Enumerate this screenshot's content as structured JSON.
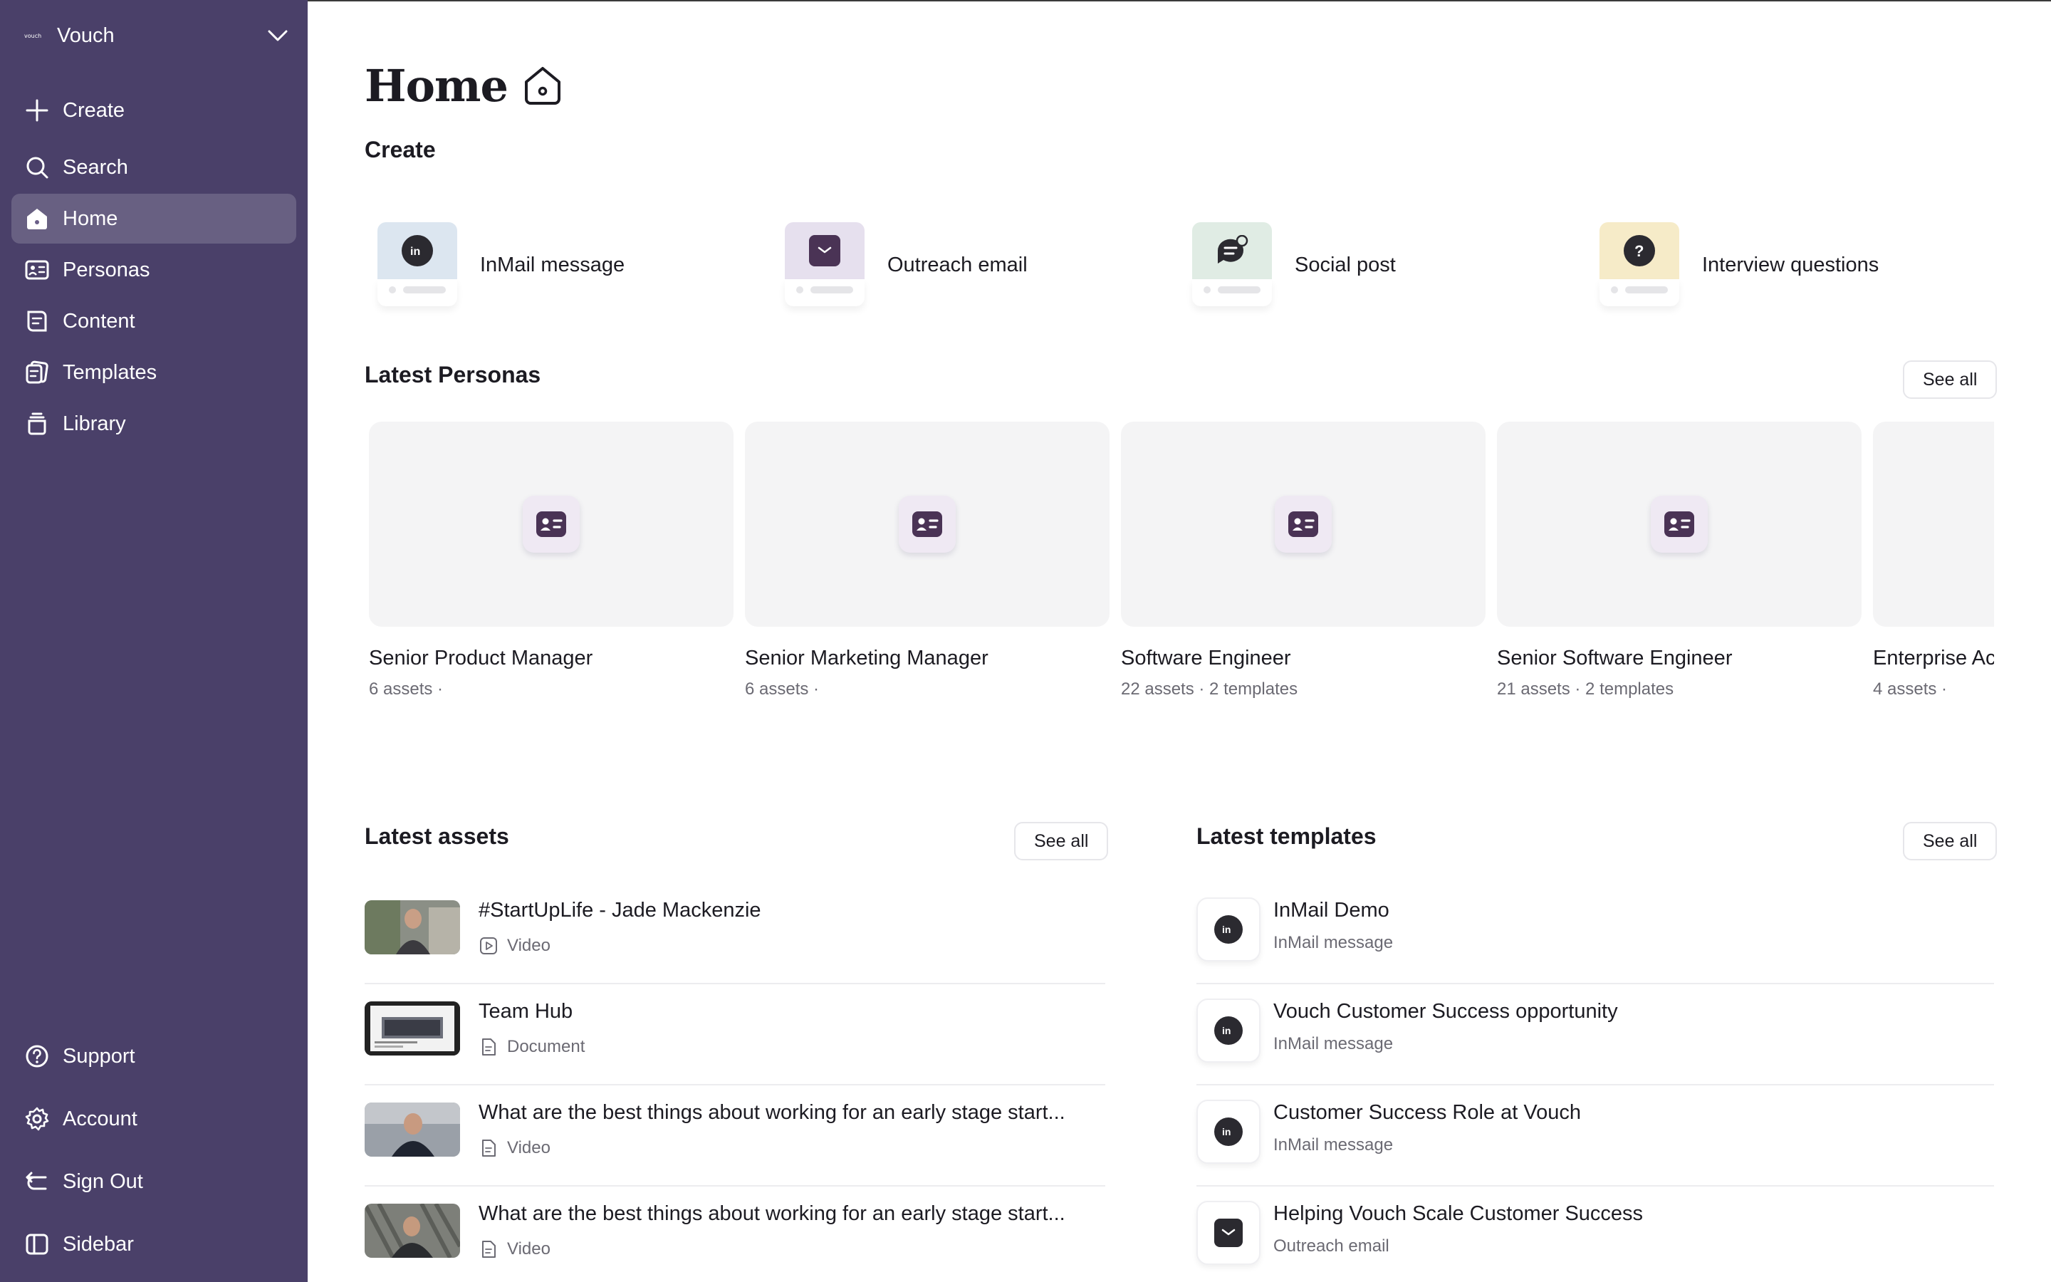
{
  "workspace": {
    "logo_text": "vouch",
    "name": "Vouch"
  },
  "sidebar": {
    "top_items": [
      {
        "label": "Create",
        "icon": "plus-icon"
      },
      {
        "label": "Search",
        "icon": "search-icon"
      },
      {
        "label": "Home",
        "icon": "home-icon",
        "active": true
      },
      {
        "label": "Personas",
        "icon": "id-card-icon"
      },
      {
        "label": "Content",
        "icon": "content-icon"
      },
      {
        "label": "Templates",
        "icon": "templates-icon"
      },
      {
        "label": "Library",
        "icon": "library-icon"
      }
    ],
    "bottom_items": [
      {
        "label": "Support",
        "icon": "help-circle-icon"
      },
      {
        "label": "Account",
        "icon": "gear-icon"
      },
      {
        "label": "Sign Out",
        "icon": "sign-out-icon"
      },
      {
        "label": "Sidebar",
        "icon": "sidebar-toggle-icon"
      }
    ]
  },
  "page": {
    "title": "Home"
  },
  "create": {
    "title": "Create",
    "items": [
      {
        "label": "InMail message",
        "icon": "linkedin-icon",
        "bg": "#dce6f0"
      },
      {
        "label": "Outreach email",
        "icon": "envelope-icon",
        "bg": "#e6e0ee"
      },
      {
        "label": "Social post",
        "icon": "chat-bubble-icon",
        "bg": "#e0ece4"
      },
      {
        "label": "Interview questions",
        "icon": "question-icon",
        "bg": "#f6ebc8"
      }
    ]
  },
  "personas": {
    "title": "Latest Personas",
    "see_all": "See all",
    "items": [
      {
        "name": "Senior Product Manager",
        "meta": "6 assets ·"
      },
      {
        "name": "Senior Marketing Manager",
        "meta": "6 assets ·"
      },
      {
        "name": "Software Engineer",
        "meta": "22 assets · 2 templates"
      },
      {
        "name": "Senior Software Engineer",
        "meta": "21 assets · 2 templates"
      },
      {
        "name": "Enterprise Ac",
        "meta": "4 assets ·"
      }
    ]
  },
  "assets": {
    "title": "Latest assets",
    "see_all": "See all",
    "items": [
      {
        "title": "#StartUpLife - Jade Mackenzie",
        "type": "Video",
        "type_icon": "video-icon"
      },
      {
        "title": "Team Hub",
        "type": "Document",
        "type_icon": "document-icon"
      },
      {
        "title": "What are the best things about working for an early stage start...",
        "type": "Video",
        "type_icon": "document-icon"
      },
      {
        "title": "What are the best things about working for an early stage start...",
        "type": "Video",
        "type_icon": "document-icon"
      }
    ]
  },
  "templates": {
    "title": "Latest templates",
    "see_all": "See all",
    "items": [
      {
        "title": "InMail Demo",
        "type": "InMail message",
        "icon": "linkedin-icon"
      },
      {
        "title": "Vouch Customer Success opportunity",
        "type": "InMail message",
        "icon": "linkedin-icon"
      },
      {
        "title": "Customer Success Role at Vouch",
        "type": "InMail message",
        "icon": "linkedin-icon"
      },
      {
        "title": "Helping Vouch Scale Customer Success",
        "type": "Outreach email",
        "icon": "envelope-icon"
      }
    ]
  },
  "colors": {
    "sidebar_bg": "#4a4069",
    "accent_dark": "#2b2a30",
    "persona_icon": "#4a3355"
  }
}
